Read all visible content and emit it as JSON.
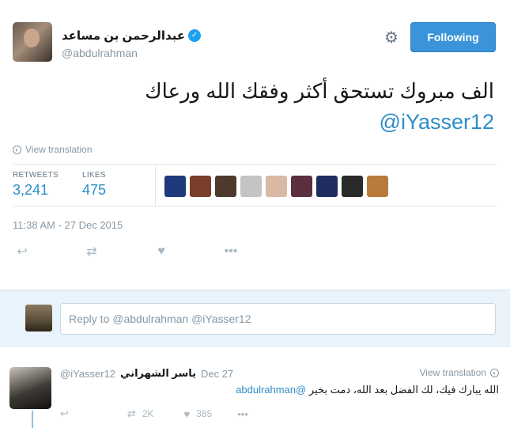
{
  "tweet": {
    "author_name": "عبدالرحمن بن مساعد",
    "author_handle": "@abdulrahman",
    "follow_label": "Following",
    "text": "الف مبروك تستحق أكثر وفقك الله ورعاك",
    "mention": "@iYasser12",
    "view_translation": "View translation",
    "retweets_label": "RETWEETS",
    "retweets_count": "3,241",
    "likes_label": "LIKES",
    "likes_count": "475",
    "timestamp": "11:38 AM - 27 Dec 2015",
    "liker_colors": [
      "#1e3a7a",
      "#7a3e2a",
      "#4d3a2c",
      "#c4c4c4",
      "#d9b9a3",
      "#5a2f3f",
      "#1f2d5f",
      "#2a2a2a",
      "#b87b3a"
    ]
  },
  "reply_box": {
    "placeholder": "Reply to @abdulrahman @iYasser12"
  },
  "reply_tweet": {
    "name": "ياسر الشهراني",
    "handle": "@iYasser12",
    "date": "Dec 27",
    "view_translation": "View translation",
    "mention": "@abdulrahman",
    "text": "الله يبارك فيك، لك الفضل بعد الله، دمت بخير",
    "retweets_count": "2K",
    "likes_count": "385"
  },
  "icons": {
    "verified": "verified-badge-icon",
    "gear": "gear-icon",
    "globe": "globe-icon",
    "reply": "reply-icon",
    "retweet": "retweet-icon",
    "like": "heart-icon",
    "more": "more-icon"
  }
}
